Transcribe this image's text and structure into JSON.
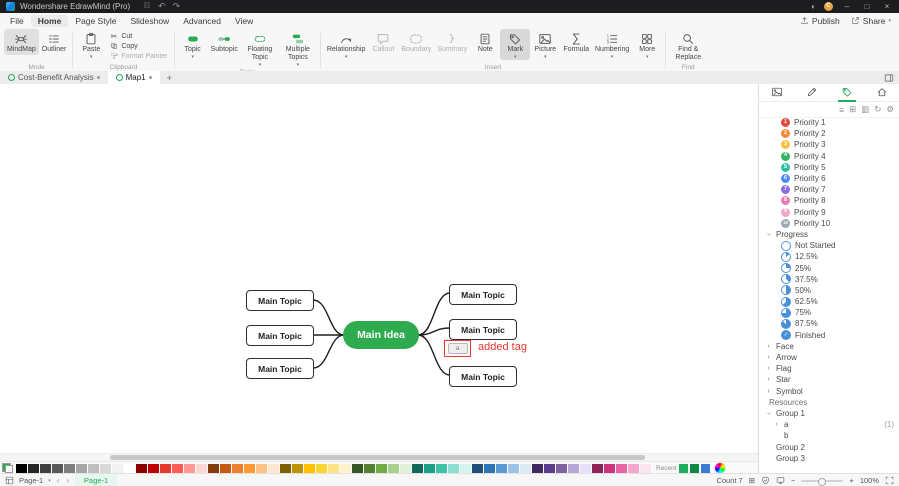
{
  "title_bar": {
    "app_title": "Wondershare EdrawMind (Pro)",
    "avatar_letter": "C"
  },
  "menu": {
    "items": [
      "File",
      "Home",
      "Page Style",
      "Slideshow",
      "Advanced",
      "View"
    ],
    "publish": "Publish",
    "share": "Share"
  },
  "ribbon": {
    "mindmap": "MindMap",
    "outliner": "Outliner",
    "paste": "Paste",
    "cut": "Cut",
    "copy": "Copy",
    "format_painter": "Format Painter",
    "topic": "Topic",
    "subtopic": "Subtopic",
    "floating_topic": "Floating Topic",
    "multiple_topics": "Multiple Topics",
    "relationship": "Relationship",
    "callout": "Callout",
    "boundary": "Boundary",
    "summary": "Summary",
    "note": "Note",
    "mark": "Mark",
    "picture": "Picture",
    "formula": "Formula",
    "numbering": "Numbering",
    "more": "More",
    "find_replace": "Find & Replace",
    "groups": {
      "mode": "Mode",
      "clipboard": "Clipboard",
      "topic": "Topic",
      "insert": "Insert",
      "find": "Find"
    }
  },
  "doc_tabs": {
    "tab1": "Cost-Benefit Analysis",
    "tab2": "Map1"
  },
  "mindmap": {
    "center": "Main Idea",
    "center_color": "#2EAB4F",
    "left_topics": [
      "Main Topic",
      "Main Topic",
      "Main Topic"
    ],
    "right_topics": [
      "Main Topic",
      "Main Topic",
      "Main Topic"
    ],
    "annotation": "added tag",
    "annotation_color": "#E8392E",
    "tag_label": "a"
  },
  "panel": {
    "priorities": [
      {
        "label": "Priority 1",
        "num": "1",
        "color": "#E5493E"
      },
      {
        "label": "Priority 2",
        "num": "2",
        "color": "#F28C3A"
      },
      {
        "label": "Priority 3",
        "num": "3",
        "color": "#F7C242"
      },
      {
        "label": "Priority 4",
        "num": "4",
        "color": "#34B764"
      },
      {
        "label": "Priority 5",
        "num": "5",
        "color": "#2FBFA7"
      },
      {
        "label": "Priority 6",
        "num": "6",
        "color": "#4B8BF4"
      },
      {
        "label": "Priority 7",
        "num": "7",
        "color": "#8A6CE0"
      },
      {
        "label": "Priority 8",
        "num": "8",
        "color": "#E87BB6"
      },
      {
        "label": "Priority 9",
        "num": "9",
        "color": "#F0A7C7"
      },
      {
        "label": "Priority 10",
        "num": "10",
        "color": "#9AA7B4"
      }
    ],
    "progress_header": "Progress",
    "progress_color": "#4A90D9",
    "progress": [
      {
        "label": "Not Started",
        "pct": 0
      },
      {
        "label": "12.5%",
        "pct": 12.5
      },
      {
        "label": "25%",
        "pct": 25
      },
      {
        "label": "37.5%",
        "pct": 37.5
      },
      {
        "label": "50%",
        "pct": 50
      },
      {
        "label": "62.5%",
        "pct": 62.5
      },
      {
        "label": "75%",
        "pct": 75
      },
      {
        "label": "87.5%",
        "pct": 87.5
      },
      {
        "label": "Finished",
        "pct": 100
      }
    ],
    "sections": [
      "Face",
      "Arrow",
      "Flag",
      "Star",
      "Symbol"
    ],
    "resources_header": "Resources",
    "group1": "Group 1",
    "item_a": "a",
    "item_a_count": "(1)",
    "item_b": "b",
    "group2": "Group 2",
    "group3": "Group 3"
  },
  "palette": {
    "colors": [
      "#000000",
      "#262626",
      "#404040",
      "#595959",
      "#7F7F7F",
      "#A6A6A6",
      "#BFBFBF",
      "#D9D9D9",
      "#F2F2F2",
      "#FFFFFF",
      "#8B0000",
      "#C00000",
      "#E8392E",
      "#FF5D55",
      "#FF9994",
      "#FFD7D5",
      "#843C0C",
      "#C55A11",
      "#ED7D31",
      "#FF9933",
      "#FFC285",
      "#FFE6CC",
      "#7F6000",
      "#BF9000",
      "#FFC000",
      "#FFD633",
      "#FFE285",
      "#FFF2CC",
      "#375623",
      "#548235",
      "#70AD47",
      "#A9D18E",
      "#E2F0D9",
      "#11695A",
      "#1D9E87",
      "#3FC1AA",
      "#8BE0D2",
      "#D5F5F0",
      "#1F4E79",
      "#2E75B6",
      "#5B9BD5",
      "#9DC3E6",
      "#DEEBF7",
      "#3F2A63",
      "#5B3E8F",
      "#8064A2",
      "#B4A7D6",
      "#E6E0F8",
      "#8E2456",
      "#C9367F",
      "#E864A5",
      "#F4A6CD",
      "#FBE5F0"
    ],
    "recent_label": "Recent",
    "recent_colors": [
      "#1DAC5C",
      "#0E8A46",
      "#3A7BD5"
    ]
  },
  "statusbar": {
    "page_selector": "Page-1",
    "active_page": "Page-1",
    "count": "Count 7",
    "zoom": "100%"
  },
  "glyphs": {
    "minimize": "–",
    "maximize": "□",
    "close": "×",
    "undo": "↶",
    "redo": "↷",
    "theme": "◐",
    "caret_down": "▾",
    "plus": "+",
    "chev_left": "‹",
    "chev_right": "›",
    "list": "≡",
    "grid": "⊞",
    "board": "▥",
    "refresh": "↻",
    "gear": "⚙",
    "formula": "∑",
    "cut": "✂",
    "minus": "−"
  }
}
